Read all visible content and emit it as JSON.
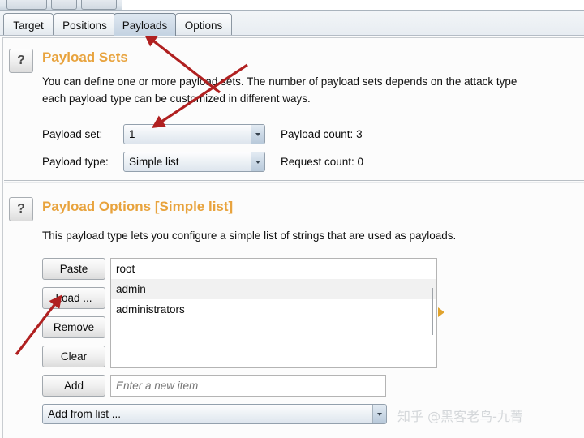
{
  "toolbar": {
    "buttons": [
      {
        "name": "toolbar-button-1",
        "label": ""
      },
      {
        "name": "toolbar-button-2",
        "label": ""
      },
      {
        "name": "toolbar-button-3",
        "label": "..."
      }
    ]
  },
  "tabs": [
    {
      "label": "Target",
      "selected": false
    },
    {
      "label": "Positions",
      "selected": false
    },
    {
      "label": "Payloads",
      "selected": true
    },
    {
      "label": "Options",
      "selected": false
    }
  ],
  "payload_sets": {
    "help_icon": "question-mark-icon",
    "help_label": "?",
    "title": "Payload Sets",
    "description_line1": "You can define one or more payload sets. The number of payload sets depends on the attack type",
    "description_line2": "each payload type can be customized in different ways.",
    "payload_set_label": "Payload set:",
    "payload_set_value": "1",
    "payload_type_label": "Payload type:",
    "payload_type_value": "Simple list",
    "payload_count_label": "Payload count: 3",
    "request_count_label": "Request count: 0"
  },
  "payload_options": {
    "help_icon": "question-mark-icon",
    "help_label": "?",
    "title": "Payload Options [Simple list]",
    "description": "This payload type lets you configure a simple list of strings that are used as payloads.",
    "buttons": {
      "paste": "Paste",
      "load": "Load ...",
      "remove": "Remove",
      "clear": "Clear",
      "add": "Add"
    },
    "list_items": [
      "root",
      "admin",
      "administrators"
    ],
    "new_item_placeholder": "Enter a new item",
    "new_item_value": "",
    "add_from_list_value": "Add from list ...",
    "collapse_arrow_icon": "triangle-right-icon"
  },
  "colors": {
    "section_title": "#e8a33d",
    "annotation_arrow": "#b02020",
    "collapse_arrow": "#e0a32e",
    "tab_selected_bg": "#cfdbe8"
  },
  "watermark": "知乎 @黑客老鸟-九菁"
}
